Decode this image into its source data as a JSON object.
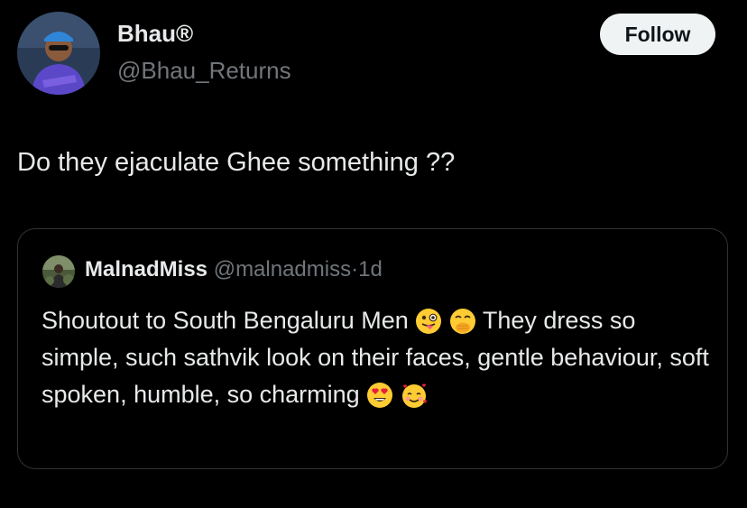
{
  "author": {
    "display_name": "Bhau®",
    "handle": "@Bhau_Returns",
    "avatar_icon": "user-avatar-photo"
  },
  "follow_button": {
    "label": "Follow",
    "bg_color": "#eff3f4",
    "text_color": "#0f1419"
  },
  "tweet": {
    "text": "Do they ejaculate Ghee something ??"
  },
  "quoted_tweet": {
    "display_name": "MalnadMiss",
    "handle": "@malnadmiss",
    "separator": "·",
    "time": "1d",
    "avatar_icon": "quoted-user-avatar-photo",
    "text_1": "Shoutout to South Bengaluru Men",
    "emoji_1": "winking-face-with-tongue-emoji",
    "emoji_2": "face-with-hand-over-mouth-emoji",
    "text_2": "They dress so simple, such sathvik look on their faces, gentle behaviour, soft spoken, humble, so charming",
    "emoji_3": "smiling-face-with-heart-eyes-emoji",
    "emoji_4": "smiling-face-with-hearts-emoji"
  },
  "colors": {
    "background": "#000000",
    "primary_text": "#e7e9ea",
    "secondary_text": "#71767b",
    "card_border": "#2f3336"
  }
}
